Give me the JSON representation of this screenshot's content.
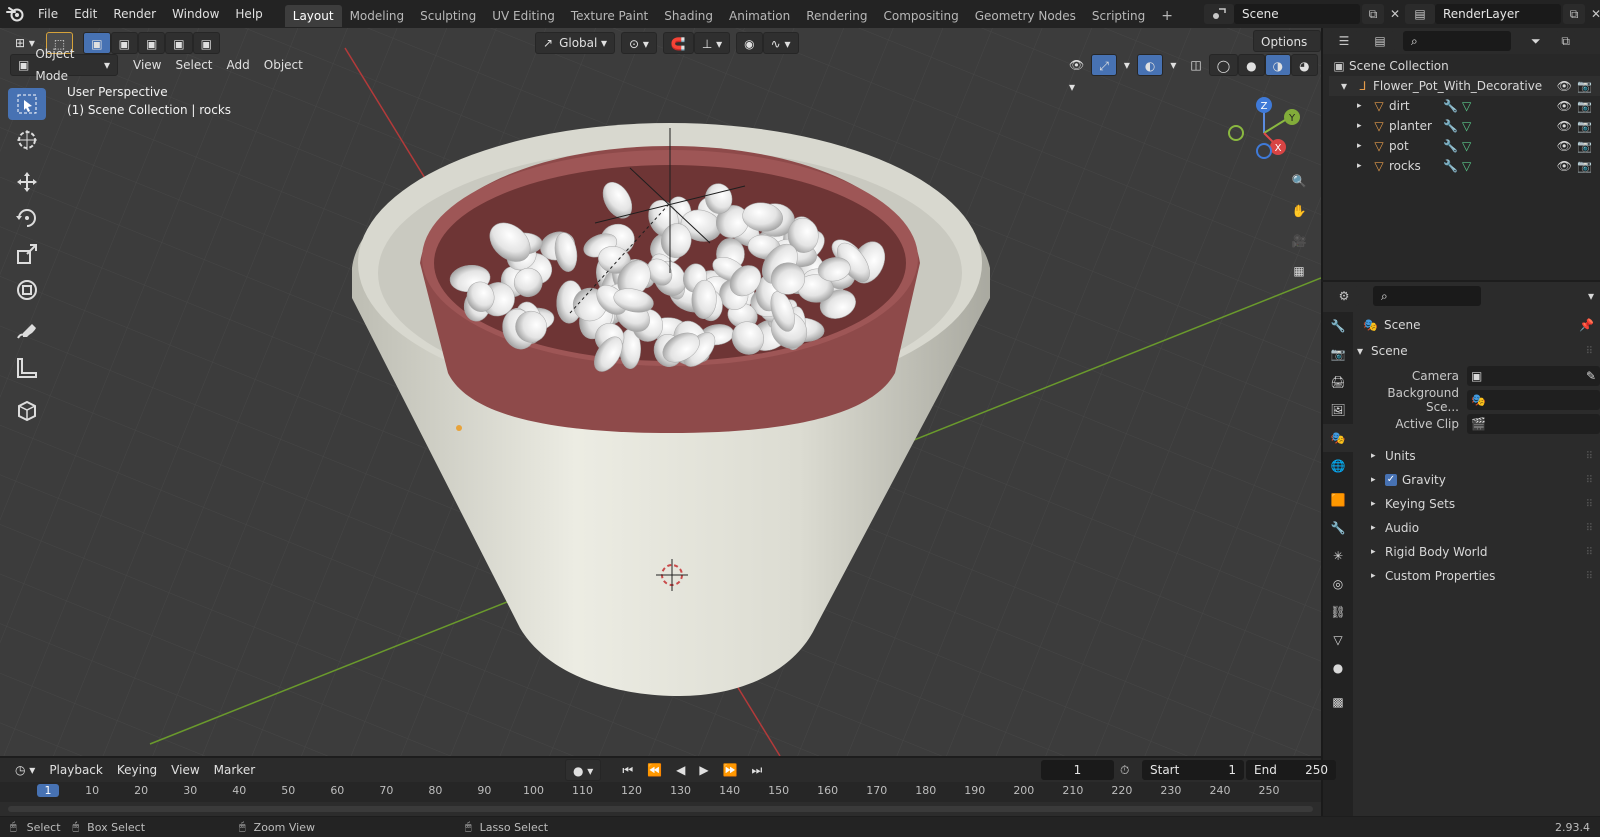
{
  "topbar": {
    "menu": [
      "File",
      "Edit",
      "Render",
      "Window",
      "Help"
    ],
    "workspaces": [
      "Layout",
      "Modeling",
      "Sculpting",
      "UV Editing",
      "Texture Paint",
      "Shading",
      "Animation",
      "Rendering",
      "Compositing",
      "Geometry Nodes",
      "Scripting"
    ],
    "active_workspace": "Layout",
    "add_workspace": "+",
    "scene_name": "Scene",
    "view_layer": "RenderLayer"
  },
  "viewport": {
    "header": {
      "transform_orientation": "Global",
      "options_label": "Options",
      "mode": "Object Mode",
      "menus": [
        "View",
        "Select",
        "Add",
        "Object"
      ]
    },
    "overlay": {
      "perspective": "User Perspective",
      "collection_info": "(1) Scene Collection | rocks"
    },
    "gizmo": {
      "z": "Z",
      "y": "Y",
      "x": "X"
    },
    "colors": {
      "background": "#3c3c3c",
      "grid": "#474747",
      "x_axis": "#b33a3a",
      "y_axis": "#6a9a2c",
      "pot": "#e6e6dc",
      "planter": "#8e4a4a",
      "rocks": "#f2f2f2"
    }
  },
  "outliner": {
    "root": "Scene Collection",
    "collection": "Flower_Pot_With_Decorative",
    "objects": [
      {
        "name": "dirt"
      },
      {
        "name": "planter"
      },
      {
        "name": "pot"
      },
      {
        "name": "rocks"
      }
    ]
  },
  "properties": {
    "context": "Scene",
    "panel_title": "Scene",
    "fields": [
      {
        "label": "Camera"
      },
      {
        "label": "Background Sce..."
      },
      {
        "label": "Active Clip"
      }
    ],
    "subpanels": [
      "Units",
      "Gravity",
      "Keying Sets",
      "Audio",
      "Rigid Body World",
      "Custom Properties"
    ],
    "gravity_checked": true
  },
  "timeline": {
    "menus": [
      "Playback",
      "Keying",
      "View",
      "Marker"
    ],
    "current_frame": "1",
    "start_label": "Start",
    "start": "1",
    "end_label": "End",
    "end": "250",
    "ticks": [
      "1",
      "10",
      "20",
      "30",
      "40",
      "50",
      "60",
      "70",
      "80",
      "90",
      "100",
      "110",
      "120",
      "130",
      "140",
      "150",
      "160",
      "170",
      "180",
      "190",
      "200",
      "210",
      "220",
      "230",
      "240",
      "250"
    ]
  },
  "statusbar": {
    "select": "Select",
    "box_select": "Box Select",
    "zoom_view": "Zoom View",
    "lasso_select": "Lasso Select",
    "version": "2.93.4"
  }
}
